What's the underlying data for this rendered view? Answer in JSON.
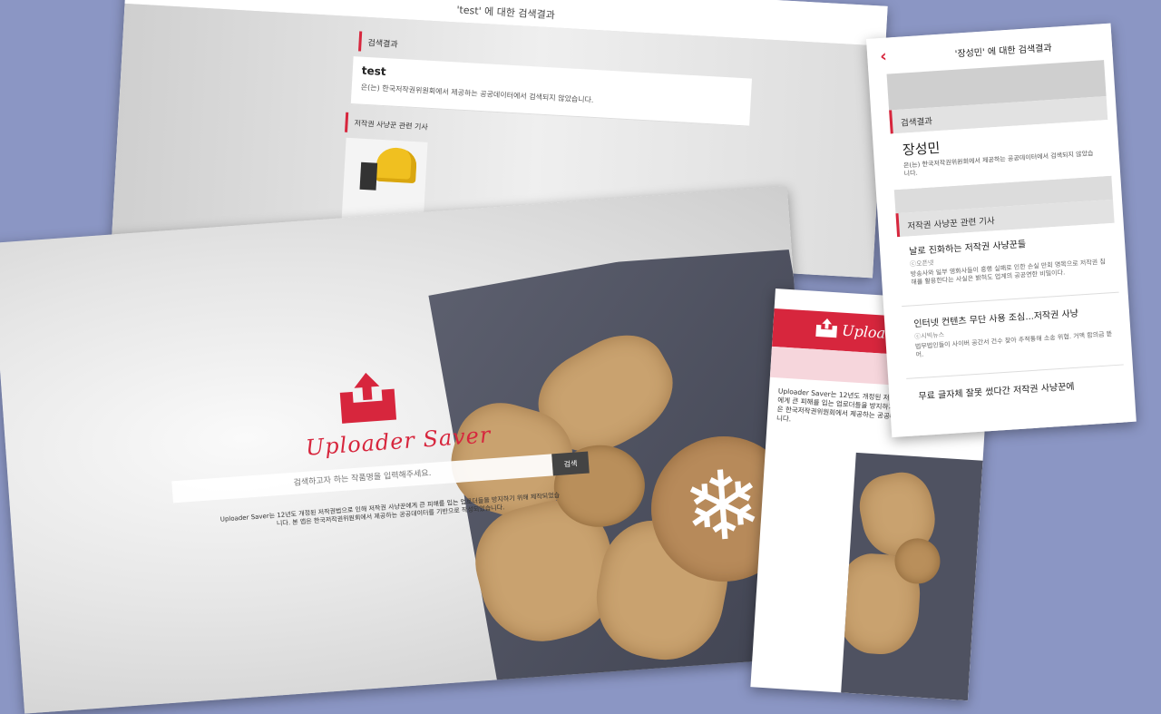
{
  "panel_a": {
    "title": "'test' 에 대한 검색결과",
    "results_label": "검색결과",
    "query": "test",
    "not_found": "은(는) 한국저작권위원회에서 제공하는 공공데이터에서 검색되지 않았습니다.",
    "articles_label": "저작권 사냥꾼 관련 기사"
  },
  "panel_b": {
    "logo_text": "Uploader Saver",
    "search_placeholder": "검색하고자 하는 작품명을 입력해주세요.",
    "search_button": "검색",
    "description": "Uploader Saver는 12년도 개정된 저작권법으로 인해 저작권 사냥꾼에게 큰 피해를 입는 업로더들을 방지하기 위해 제작되었습니다. 본 앱은 한국저작권위원회에서 제공하는 공공데이터를 기반으로 작성되었습니다."
  },
  "panel_c": {
    "logo_text": "Uploader",
    "description": "Uploader Saver는 12년도 개정된 저작권법으로 인해 저작권 사냥꾼에게 큰 피해를 입는 업로더들을 방지하기 위해 제작되었습니다. 본 앱은 한국저작권위원회에서 제공하는 공공데이터를 기반으로 작성되었습니다."
  },
  "panel_d": {
    "title": "'장성민' 에 대한 검색결과",
    "results_label": "검색결과",
    "query": "장성민",
    "not_found": "은(는) 한국저작권위원회에서 제공하는 공공데이터에서 검색되지 않았습니다.",
    "articles_label": "저작권 사냥꾼 관련 기사",
    "articles": [
      {
        "title": "날로 진화하는 저작권 사냥꾼들",
        "source": "ⓒ오픈넷",
        "snippet": "방송사와 일부 영화사들이 흥행 실패로 인한 손실 만회 명목으로 저작권 침해를 활용한다는 사실은 밝혀도 업계의 공공연한 비밀이다."
      },
      {
        "title": "인터넷 컨텐츠 무단 사용 조심...저작권 사냥",
        "source": "ⓒ시빅뉴스",
        "snippet": "법무법인들이 사이버 공간서 건수 찾아 추적통해 소송 위협. 거액 합의금 뜯어."
      },
      {
        "title": "무료 글자체 잘못 썼다간 저작권 사냥꾼에",
        "source": "",
        "snippet": ""
      }
    ]
  }
}
